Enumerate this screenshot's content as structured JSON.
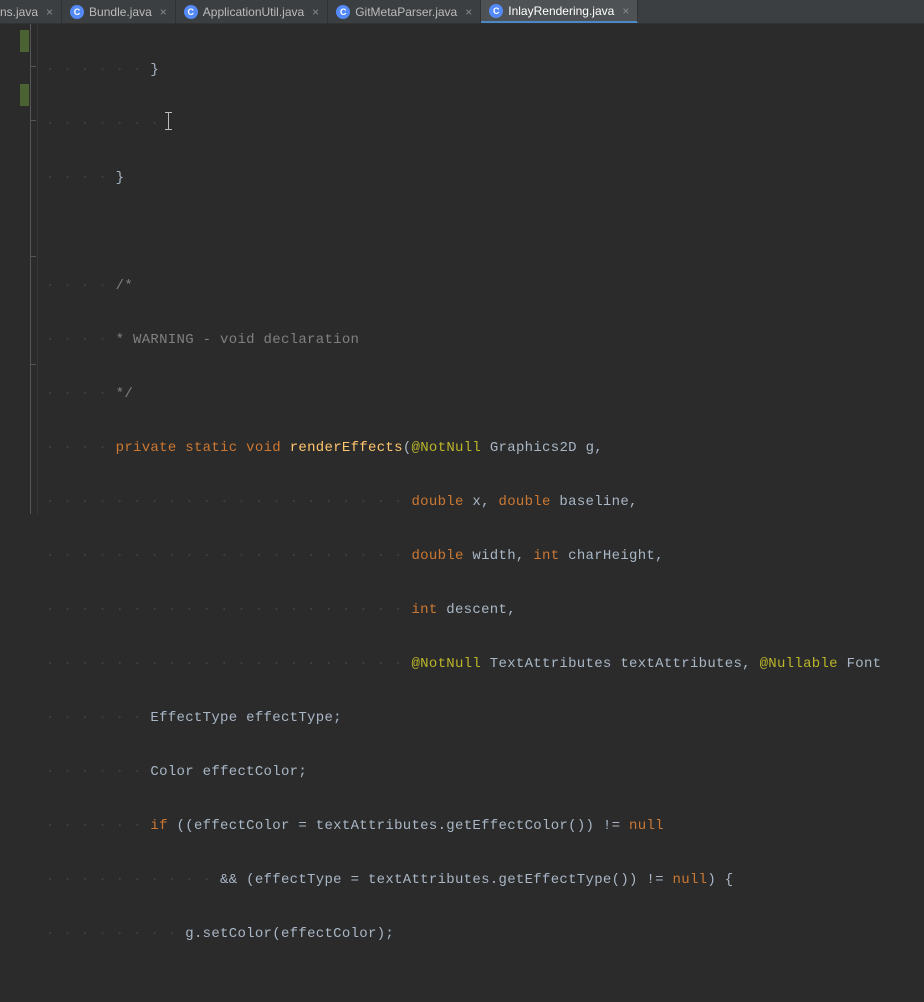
{
  "tabs": [
    {
      "label": "ns.java",
      "partial": true,
      "active": false,
      "hasIcon": false
    },
    {
      "label": "Bundle.java",
      "active": false,
      "hasIcon": true
    },
    {
      "label": "ApplicationUtil.java",
      "active": false,
      "hasIcon": true
    },
    {
      "label": "GitMetaParser.java",
      "active": false,
      "hasIcon": true
    },
    {
      "label": "InlayRendering.java",
      "active": true,
      "hasIcon": true
    }
  ],
  "colors": {
    "keyword": "#cc7832",
    "annotation": "#bbb529",
    "function": "#ffc66d",
    "comment": "#808080",
    "default": "#a9b7c6"
  },
  "code": {
    "l1_brace": "}",
    "l2_empty": "",
    "l3_brace": "}",
    "l4_empty": "",
    "l5_c1": "/*",
    "l6_c2": " * WARNING - void declaration",
    "l7_c3": " */",
    "l8_kw1": "private",
    "l8_kw2": "static",
    "l8_kw3": "void",
    "l8_fn": "renderEffects",
    "l8_anno": "@NotNull",
    "l8_t1": "Graphics2D",
    "l8_p1": "g",
    "l9_kw1": "double",
    "l9_p1": "x",
    "l9_kw2": "double",
    "l9_p2": "baseline",
    "l10_kw1": "double",
    "l10_p1": "width",
    "l10_kw2": "int",
    "l10_p2": "charHeight",
    "l11_kw1": "int",
    "l11_p1": "descent",
    "l12_anno1": "@NotNull",
    "l12_t1": "TextAttributes",
    "l12_p1": "textAttributes",
    "l12_anno2": "@Nullable",
    "l12_t2": "Font",
    "l13_t": "EffectType",
    "l13_v": "effectType",
    "l14_t": "Color",
    "l14_v": "effectColor",
    "l15_kw": "if",
    "l15_v1": "effectColor",
    "l15_v2": "textAttributes",
    "l15_m": "getEffectColor",
    "l15_null": "null",
    "l16_op": "&&",
    "l16_v1": "effectType",
    "l16_v2": "textAttributes",
    "l16_m": "getEffectType",
    "l16_null": "null",
    "l17_v": "g",
    "l17_m": "setColor",
    "l17_a": "effectColor"
  }
}
